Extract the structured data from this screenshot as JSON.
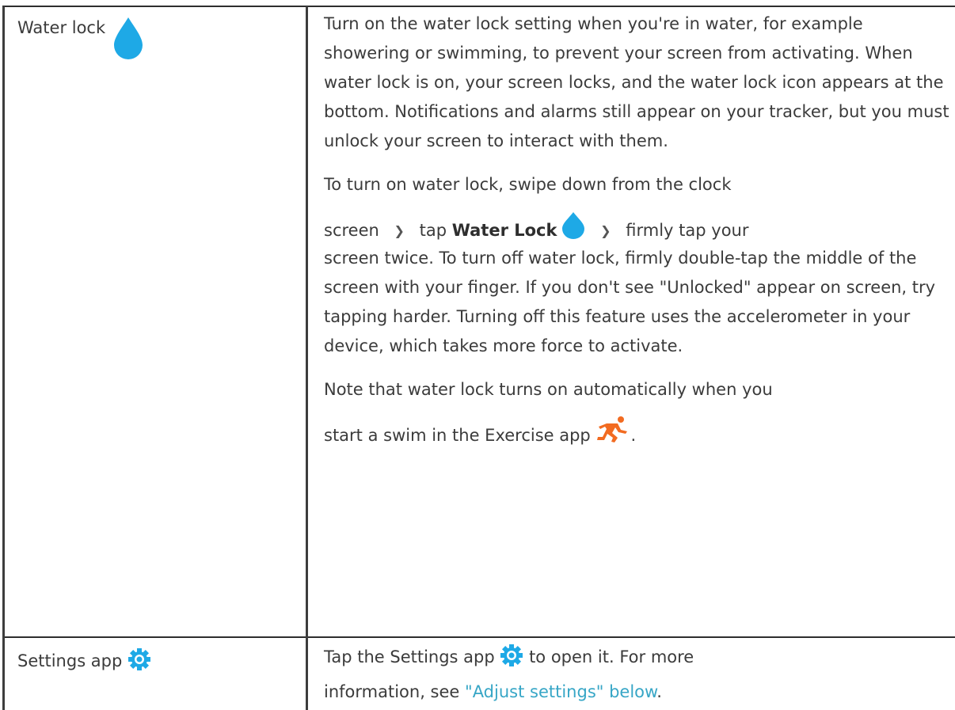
{
  "table": {
    "rows": [
      {
        "label": "Water lock",
        "label_icon": "water-drop-icon",
        "para1": "Turn on the water lock setting when you're in water, for example showering or swimming, to prevent your screen from activating. When water lock is on, your screen locks, and the water lock icon appears at the bottom. Notifications and alarms still appear on your tracker, but you must unlock your screen to interact with them.",
        "para2_line1": "To turn on water lock, swipe down from the clock",
        "para2_screen": "screen",
        "para2_tap": "tap",
        "para2_water_lock": "Water Lock",
        "para2_firmly": "firmly tap your",
        "para2_rest": "screen twice. To turn off water lock, firmly double-tap the middle of the screen with your finger. If you don't see \"Unlocked\" appear on screen, try tapping harder. Turning off this feature uses the accelerometer in your device, which takes more force to activate.",
        "para3_line1": "Note that water lock turns on automatically when you",
        "para3_line2": "start a swim in the Exercise app",
        "para3_end": "."
      },
      {
        "label": "Settings app",
        "label_icon": "settings-gear-icon",
        "desc_start": "Tap the Settings app",
        "desc_after": "to open it. For more",
        "desc_line2": "information, see",
        "link_text": "\"Adjust settings\" below",
        "desc_end": "."
      }
    ]
  },
  "colors": {
    "drop": "#1ea9e6",
    "gear": "#1ea9e6",
    "runner": "#f26b21",
    "link": "#37a6c6",
    "border": "#2e2e2e"
  }
}
